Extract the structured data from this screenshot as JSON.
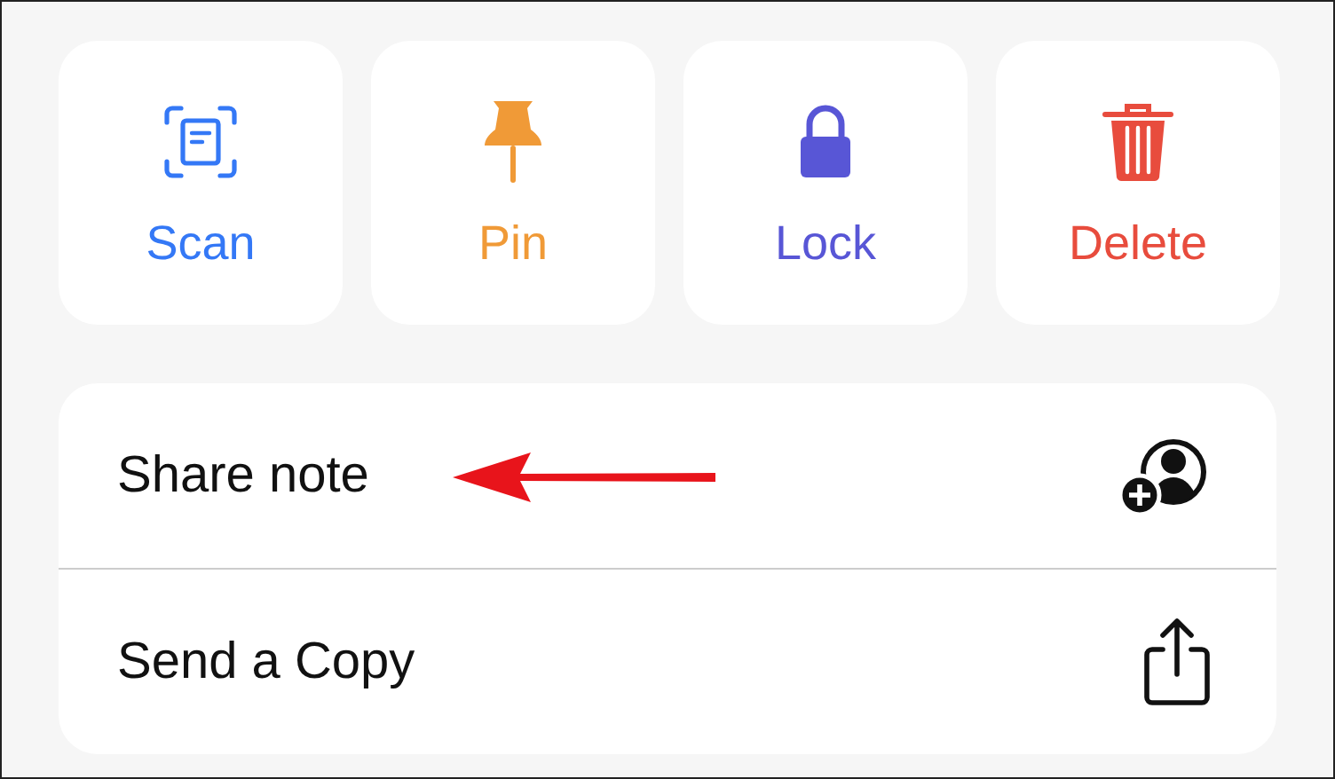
{
  "actions": [
    {
      "kind": "scan",
      "label": "Scan",
      "color": "#3478f6"
    },
    {
      "kind": "pin",
      "label": "Pin",
      "color": "#f09a37"
    },
    {
      "kind": "lock",
      "label": "Lock",
      "color": "#5856d6"
    },
    {
      "kind": "delete",
      "label": "Delete",
      "color": "#e84c3d"
    }
  ],
  "menu": [
    {
      "kind": "share",
      "label": "Share note",
      "annotated": true
    },
    {
      "kind": "send",
      "label": "Send a Copy",
      "annotated": false
    }
  ]
}
